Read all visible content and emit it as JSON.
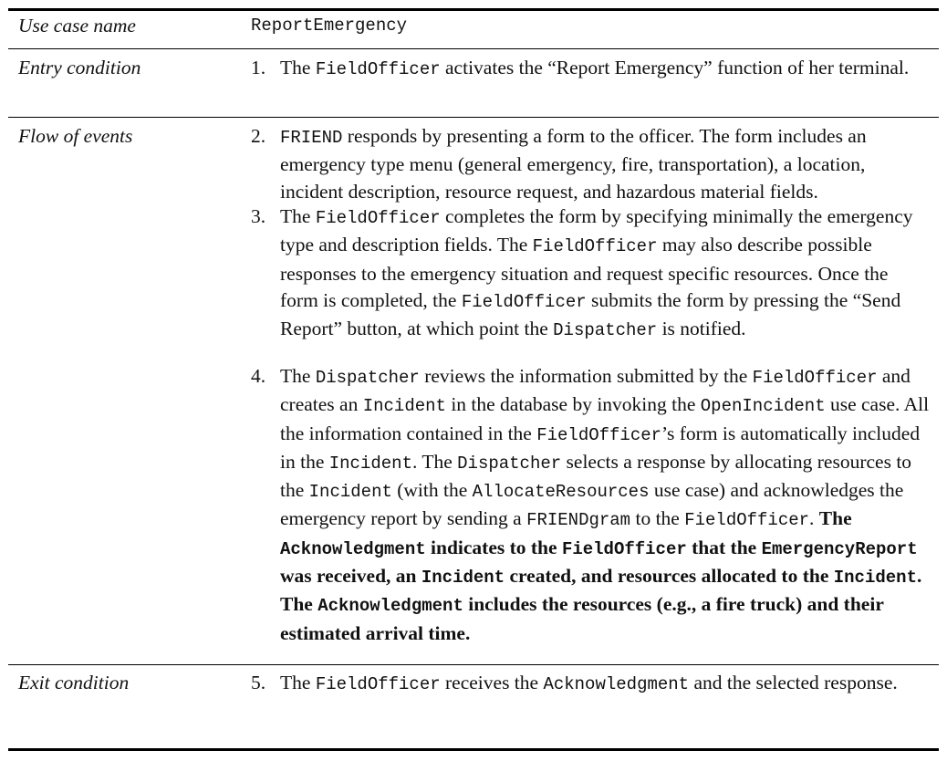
{
  "rows": {
    "name": {
      "label": "Use case name",
      "value": "ReportEmergency"
    },
    "entry": {
      "label": "Entry condition"
    },
    "flow": {
      "label": "Flow of events"
    },
    "exit": {
      "label": "Exit condition"
    }
  },
  "step1": {
    "num": "1.",
    "parts": [
      "The ",
      "FieldOfficer",
      " activates the “Report Emergency” function of her terminal."
    ]
  },
  "step2": {
    "num": "2.",
    "parts": [
      "FRIEND",
      " responds by presenting a form to the officer. The form includes an emergency type menu (general emergency, fire, transportation), a location, incident description, resource request, and hazardous material fields."
    ]
  },
  "step3": {
    "num": "3.",
    "parts": [
      "The ",
      "FieldOfficer",
      " completes the form by specifying minimally the emergency type and description fields. The ",
      "FieldOfficer",
      " may also describe possible responses to the emergency situation and request specific resources. Once the form is completed, the ",
      "FieldOfficer",
      " submits the form by pressing the “Send Report” button, at which point the ",
      "Dispatcher",
      " is notified."
    ]
  },
  "step4": {
    "num": "4.",
    "parts": [
      "The ",
      "Dispatcher",
      " reviews the information submitted by the ",
      "FieldOfficer",
      " and creates an ",
      "Incident",
      " in the database by invoking the ",
      "OpenIncident",
      " use case. All the information contained in the ",
      "FieldOfficer",
      "’s form is automatically included in the ",
      "Incident",
      ". The ",
      "Dispatcher",
      " selects a response by allocating resources to the ",
      "Incident",
      " (with the ",
      "AllocateResources",
      " use case) and acknowledges the emergency report by sending a ",
      "FRIENDgram",
      " to the ",
      "FieldOfficer",
      ". "
    ],
    "bold_parts": [
      "The ",
      "Acknowledgment",
      " indicates to the ",
      "FieldOfficer",
      " that the ",
      "EmergencyReport",
      " was received, an ",
      "Incident",
      " created, and resources allocated to the ",
      "Incident",
      ". The ",
      "Acknowledgment",
      " includes the resources (e.g., a fire truck) and their estimated arrival time."
    ]
  },
  "step5": {
    "num": "5.",
    "parts": [
      "The ",
      "FieldOfficer",
      " receives the ",
      "Acknowledgment",
      " and the selected response."
    ]
  }
}
